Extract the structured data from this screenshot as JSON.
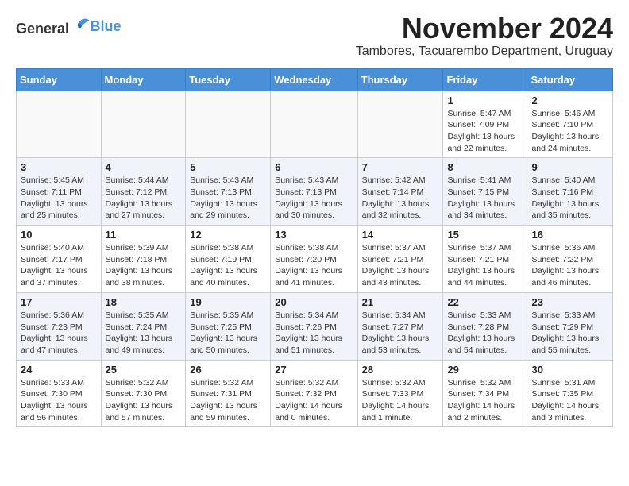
{
  "logo": {
    "general": "General",
    "blue": "Blue"
  },
  "header": {
    "month_title": "November 2024",
    "subtitle": "Tambores, Tacuarembo Department, Uruguay"
  },
  "weekdays": [
    "Sunday",
    "Monday",
    "Tuesday",
    "Wednesday",
    "Thursday",
    "Friday",
    "Saturday"
  ],
  "weeks": [
    [
      {
        "day": "",
        "info": ""
      },
      {
        "day": "",
        "info": ""
      },
      {
        "day": "",
        "info": ""
      },
      {
        "day": "",
        "info": ""
      },
      {
        "day": "",
        "info": ""
      },
      {
        "day": "1",
        "info": "Sunrise: 5:47 AM\nSunset: 7:09 PM\nDaylight: 13 hours and 22 minutes."
      },
      {
        "day": "2",
        "info": "Sunrise: 5:46 AM\nSunset: 7:10 PM\nDaylight: 13 hours and 24 minutes."
      }
    ],
    [
      {
        "day": "3",
        "info": "Sunrise: 5:45 AM\nSunset: 7:11 PM\nDaylight: 13 hours and 25 minutes."
      },
      {
        "day": "4",
        "info": "Sunrise: 5:44 AM\nSunset: 7:12 PM\nDaylight: 13 hours and 27 minutes."
      },
      {
        "day": "5",
        "info": "Sunrise: 5:43 AM\nSunset: 7:13 PM\nDaylight: 13 hours and 29 minutes."
      },
      {
        "day": "6",
        "info": "Sunrise: 5:43 AM\nSunset: 7:13 PM\nDaylight: 13 hours and 30 minutes."
      },
      {
        "day": "7",
        "info": "Sunrise: 5:42 AM\nSunset: 7:14 PM\nDaylight: 13 hours and 32 minutes."
      },
      {
        "day": "8",
        "info": "Sunrise: 5:41 AM\nSunset: 7:15 PM\nDaylight: 13 hours and 34 minutes."
      },
      {
        "day": "9",
        "info": "Sunrise: 5:40 AM\nSunset: 7:16 PM\nDaylight: 13 hours and 35 minutes."
      }
    ],
    [
      {
        "day": "10",
        "info": "Sunrise: 5:40 AM\nSunset: 7:17 PM\nDaylight: 13 hours and 37 minutes."
      },
      {
        "day": "11",
        "info": "Sunrise: 5:39 AM\nSunset: 7:18 PM\nDaylight: 13 hours and 38 minutes."
      },
      {
        "day": "12",
        "info": "Sunrise: 5:38 AM\nSunset: 7:19 PM\nDaylight: 13 hours and 40 minutes."
      },
      {
        "day": "13",
        "info": "Sunrise: 5:38 AM\nSunset: 7:20 PM\nDaylight: 13 hours and 41 minutes."
      },
      {
        "day": "14",
        "info": "Sunrise: 5:37 AM\nSunset: 7:21 PM\nDaylight: 13 hours and 43 minutes."
      },
      {
        "day": "15",
        "info": "Sunrise: 5:37 AM\nSunset: 7:21 PM\nDaylight: 13 hours and 44 minutes."
      },
      {
        "day": "16",
        "info": "Sunrise: 5:36 AM\nSunset: 7:22 PM\nDaylight: 13 hours and 46 minutes."
      }
    ],
    [
      {
        "day": "17",
        "info": "Sunrise: 5:36 AM\nSunset: 7:23 PM\nDaylight: 13 hours and 47 minutes."
      },
      {
        "day": "18",
        "info": "Sunrise: 5:35 AM\nSunset: 7:24 PM\nDaylight: 13 hours and 49 minutes."
      },
      {
        "day": "19",
        "info": "Sunrise: 5:35 AM\nSunset: 7:25 PM\nDaylight: 13 hours and 50 minutes."
      },
      {
        "day": "20",
        "info": "Sunrise: 5:34 AM\nSunset: 7:26 PM\nDaylight: 13 hours and 51 minutes."
      },
      {
        "day": "21",
        "info": "Sunrise: 5:34 AM\nSunset: 7:27 PM\nDaylight: 13 hours and 53 minutes."
      },
      {
        "day": "22",
        "info": "Sunrise: 5:33 AM\nSunset: 7:28 PM\nDaylight: 13 hours and 54 minutes."
      },
      {
        "day": "23",
        "info": "Sunrise: 5:33 AM\nSunset: 7:29 PM\nDaylight: 13 hours and 55 minutes."
      }
    ],
    [
      {
        "day": "24",
        "info": "Sunrise: 5:33 AM\nSunset: 7:30 PM\nDaylight: 13 hours and 56 minutes."
      },
      {
        "day": "25",
        "info": "Sunrise: 5:32 AM\nSunset: 7:30 PM\nDaylight: 13 hours and 57 minutes."
      },
      {
        "day": "26",
        "info": "Sunrise: 5:32 AM\nSunset: 7:31 PM\nDaylight: 13 hours and 59 minutes."
      },
      {
        "day": "27",
        "info": "Sunrise: 5:32 AM\nSunset: 7:32 PM\nDaylight: 14 hours and 0 minutes."
      },
      {
        "day": "28",
        "info": "Sunrise: 5:32 AM\nSunset: 7:33 PM\nDaylight: 14 hours and 1 minute."
      },
      {
        "day": "29",
        "info": "Sunrise: 5:32 AM\nSunset: 7:34 PM\nDaylight: 14 hours and 2 minutes."
      },
      {
        "day": "30",
        "info": "Sunrise: 5:31 AM\nSunset: 7:35 PM\nDaylight: 14 hours and 3 minutes."
      }
    ]
  ]
}
